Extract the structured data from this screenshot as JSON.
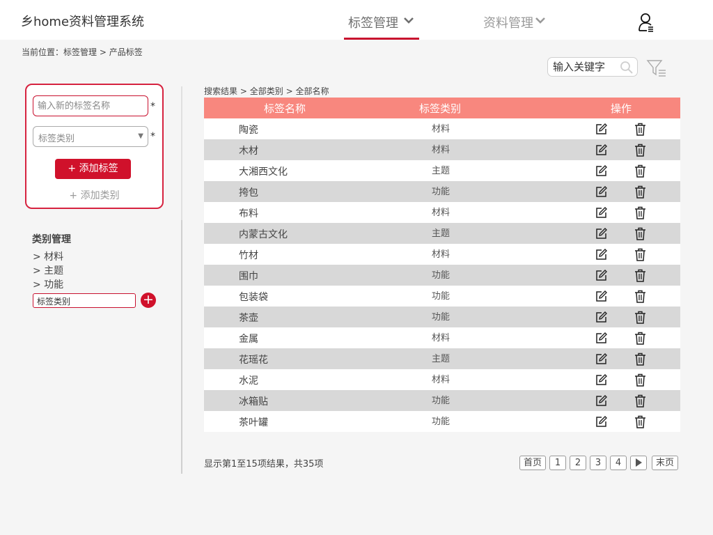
{
  "header": {
    "app_title": "乡home资料管理系统",
    "nav": [
      {
        "label": "标签管理",
        "current": true
      },
      {
        "label": "资料管理",
        "current": false
      }
    ]
  },
  "breadcrumb": {
    "prefix": "当前位置：",
    "path": [
      "标签管理",
      "产品标签"
    ],
    "separator": ">"
  },
  "search": {
    "placeholder": "输入关键字"
  },
  "add_panel": {
    "name_placeholder": "输入新的标签名称",
    "category_placeholder": "标签类别",
    "required_mark": "*",
    "add_button": "+ 添加标签",
    "add_category_link": "+ 添加类别"
  },
  "category_manage": {
    "title": "类别管理",
    "items": [
      "> 材料",
      "> 主题",
      "> 功能"
    ],
    "new_input_value": "标签类别",
    "add_button": "+"
  },
  "results": {
    "crumb": [
      "搜索结果",
      "全部类别",
      "全部名称"
    ],
    "separator": ">",
    "columns": [
      "标签名称",
      "标签类别",
      "操作"
    ],
    "rows": [
      {
        "name": "陶瓷",
        "type": "材料"
      },
      {
        "name": "木材",
        "type": "材料"
      },
      {
        "name": "大湘西文化",
        "type": "主题"
      },
      {
        "name": "挎包",
        "type": "功能"
      },
      {
        "name": "布料",
        "type": "材料"
      },
      {
        "name": "内蒙古文化",
        "type": "主题"
      },
      {
        "name": "竹材",
        "type": "材料"
      },
      {
        "name": "围巾",
        "type": "功能"
      },
      {
        "name": "包装袋",
        "type": "功能"
      },
      {
        "name": "茶壶",
        "type": "功能"
      },
      {
        "name": "金属",
        "type": "材料"
      },
      {
        "name": "花瑶花",
        "type": "主题"
      },
      {
        "name": "水泥",
        "type": "材料"
      },
      {
        "name": "冰箱贴",
        "type": "功能"
      },
      {
        "name": "茶叶罐",
        "type": "功能"
      }
    ],
    "summary": "显示第1至15项结果，共35项"
  },
  "pagination": {
    "first": "首页",
    "pages": [
      "1",
      "2",
      "3",
      "4"
    ],
    "next_icon": "play-right-icon",
    "last": "末页"
  },
  "colors": {
    "accent": "#c8102e",
    "table_header": "#f8877e",
    "row_alt": "#d8d8d8"
  }
}
